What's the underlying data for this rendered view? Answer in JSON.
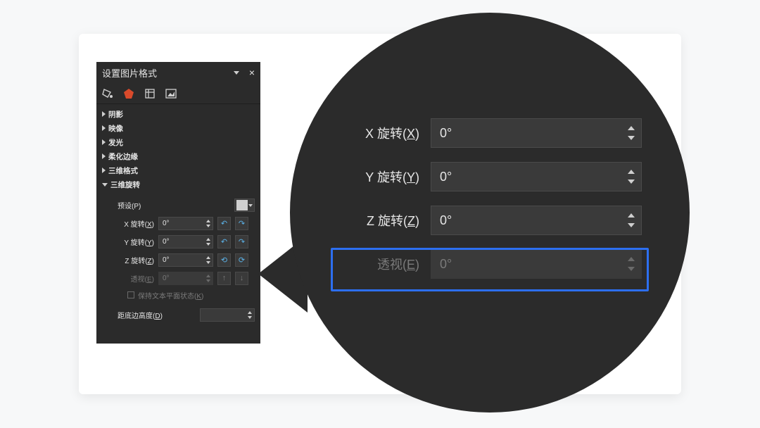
{
  "panel": {
    "title": "设置图片格式",
    "sections": {
      "shadow": "阴影",
      "reflection": "映像",
      "glow": "发光",
      "soft_edge": "柔化边缘",
      "format_3d": "三维格式",
      "rotation_3d": "三维旋转"
    },
    "preset_label": "预设(P)",
    "x_rotation_label": "X 旋转(X)",
    "y_rotation_label": "Y 旋转(Y)",
    "z_rotation_label": "Z 旋转(Z)",
    "perspective_label": "透视(E)",
    "x_rotation_value": "0°",
    "y_rotation_value": "0°",
    "z_rotation_value": "0°",
    "perspective_value": "0°",
    "keep_flat_label": "保持文本平面状态(K)",
    "distance_label": "距底边高度(D)",
    "distance_value": ""
  },
  "mag": {
    "x_label": "X 旋转(X)",
    "y_label": "Y 旋转(Y)",
    "z_label": "Z 旋转(Z)",
    "p_label": "透视(E)",
    "x_value": "0°",
    "y_value": "0°",
    "z_value": "0°",
    "p_value": "0°"
  }
}
